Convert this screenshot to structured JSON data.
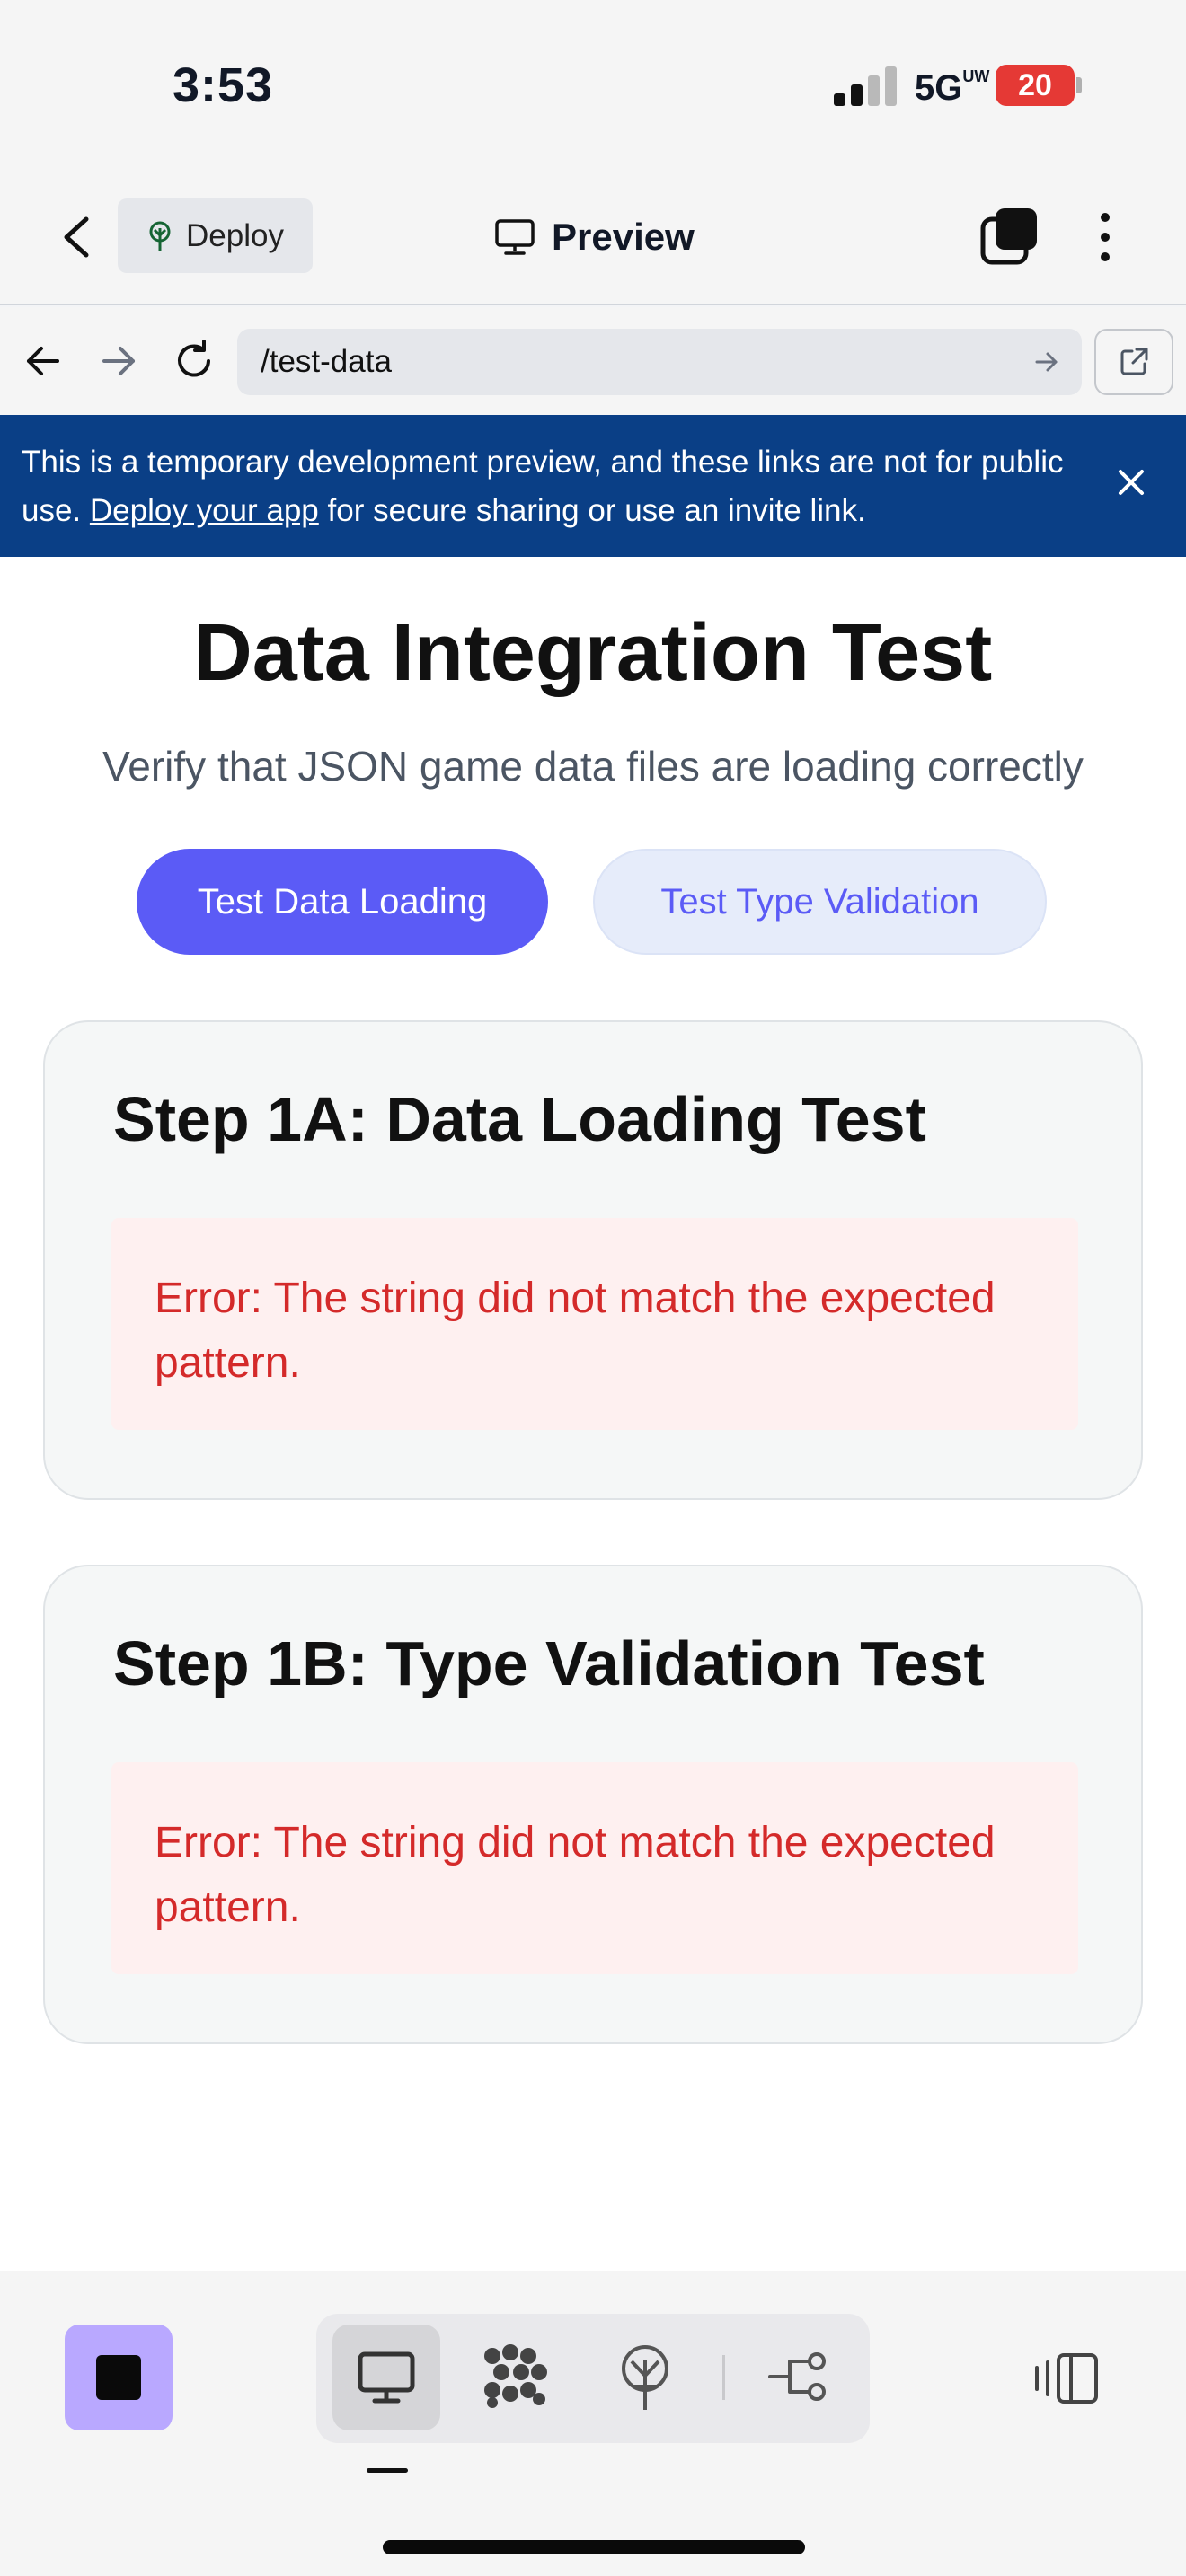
{
  "status_bar": {
    "time": "3:53",
    "network": "5G",
    "network_sup": "UW",
    "battery": "20"
  },
  "toolbar": {
    "deploy_label": "Deploy",
    "preview_label": "Preview"
  },
  "browser": {
    "url": "/test-data"
  },
  "banner": {
    "text_before": "This is a temporary development preview, and these links are not for public use. ",
    "link_text": "Deploy your app",
    "text_after": " for secure sharing or use an invite link."
  },
  "page": {
    "title": "Data Integration Test",
    "subtitle": "Verify that JSON game data files are loading correctly",
    "primary_button": "Test Data Loading",
    "secondary_button": "Test Type Validation",
    "cards": [
      {
        "title": "Step 1A: Data Loading Test",
        "error": "Error: The string did not match the expected pattern."
      },
      {
        "title": "Step 1B: Type Validation Test",
        "error": "Error: The string did not match the expected pattern."
      }
    ]
  },
  "colors": {
    "primary": "#5b5bf6",
    "banner": "#0a3f86",
    "error_text": "#d42a2a",
    "error_bg": "#fef0f0",
    "battery": "#e53935",
    "stop_button": "#b9a8ff"
  },
  "icons": {
    "toolbar": [
      "back-chevron-icon",
      "tree-icon",
      "monitor-icon",
      "tabs-icon",
      "more-vertical-icon"
    ],
    "browser": [
      "back-arrow-icon",
      "forward-arrow-icon",
      "reload-icon",
      "go-arrow-icon",
      "open-external-icon"
    ],
    "banner": [
      "close-icon"
    ],
    "dock": [
      "stop-icon",
      "monitor-icon",
      "grid-dots-icon",
      "deploy-tree-icon",
      "flow-icon",
      "panel-toggle-icon"
    ]
  }
}
